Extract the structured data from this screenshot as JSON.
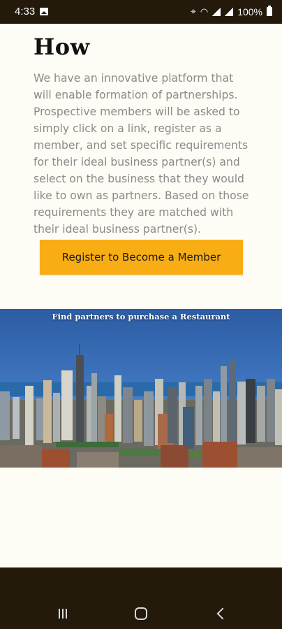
{
  "status_bar": {
    "time": "4:33",
    "battery": "100%",
    "icons": [
      "image-icon",
      "location-icon",
      "wifi-icon",
      "signal-icon",
      "volte-icon",
      "battery-icon"
    ]
  },
  "section": {
    "title": "How",
    "body": "We have an innovative platform that will enable formation of partnerships. Prospective members will be asked to simply click on a link, register as a member, and set specific requirements for their ideal business partner(s) and select on the business that they would like to own as partners. Based on those requirements they are matched with their ideal business partner(s).",
    "cta_label": "Register to Become a Member"
  },
  "hero": {
    "caption": "Find partners to purchase a Restaurant"
  },
  "nav": {
    "icons": [
      "recent-apps-icon",
      "home-icon",
      "back-icon"
    ]
  },
  "colors": {
    "background": "#fdfcf5",
    "system_bar": "#231a0c",
    "accent": "#f9ad15",
    "body_text": "#8a8a8a",
    "title_text": "#111111"
  }
}
